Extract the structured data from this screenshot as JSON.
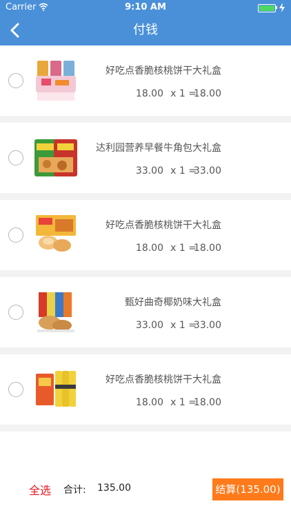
{
  "status_bar": {
    "carrier": "Carrier",
    "time": "9:10 AM"
  },
  "nav": {
    "title": "付钱"
  },
  "items": [
    {
      "name": "好吃点香脆核桃饼干大礼盒",
      "price": "18.00",
      "qty": "x 1 =",
      "subtotal": "18.00"
    },
    {
      "name": "达利园营养早餐牛角包大礼盒",
      "price": "33.00",
      "qty": "x 1 =",
      "subtotal": "33.00"
    },
    {
      "name": "好吃点香脆核桃饼干大礼盒",
      "price": "18.00",
      "qty": "x 1 =",
      "subtotal": "18.00"
    },
    {
      "name": "甄好曲奇椰奶味大礼盒",
      "price": "33.00",
      "qty": "x 1 =",
      "subtotal": "33.00"
    },
    {
      "name": "好吃点香脆核桃饼干大礼盒",
      "price": "18.00",
      "qty": "x 1 =",
      "subtotal": "18.00"
    }
  ],
  "footer": {
    "select_all": "全选",
    "total_label": "合计:",
    "total_value": "135.00",
    "checkout": "结算(135.00)"
  },
  "colors": {
    "nav_bg": "#4a90d9",
    "accent_red": "#e5191f",
    "checkout_bg": "#ff7a1a"
  }
}
